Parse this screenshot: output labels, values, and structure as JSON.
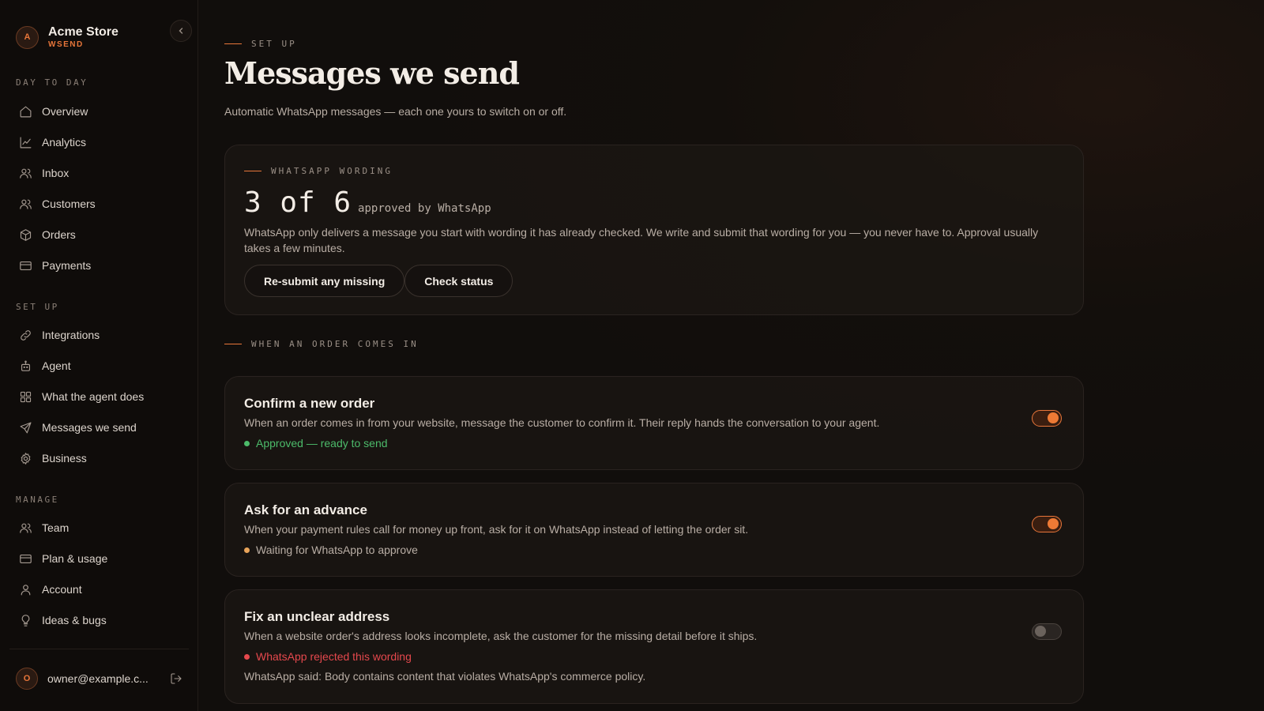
{
  "brand": {
    "initial": "A",
    "name": "Acme Store",
    "product": "WSEND"
  },
  "nav": {
    "sections": [
      {
        "label": "DAY TO DAY",
        "items": [
          {
            "label": "Overview",
            "icon": "home-icon"
          },
          {
            "label": "Analytics",
            "icon": "chart-icon"
          },
          {
            "label": "Inbox",
            "icon": "users-icon"
          },
          {
            "label": "Customers",
            "icon": "users-icon"
          },
          {
            "label": "Orders",
            "icon": "box-icon"
          },
          {
            "label": "Payments",
            "icon": "card-icon"
          }
        ]
      },
      {
        "label": "SET UP",
        "items": [
          {
            "label": "Integrations",
            "icon": "link-icon"
          },
          {
            "label": "Agent",
            "icon": "bot-icon"
          },
          {
            "label": "What the agent does",
            "icon": "grid-icon"
          },
          {
            "label": "Messages we send",
            "icon": "send-icon"
          },
          {
            "label": "Business",
            "icon": "gear-icon"
          }
        ]
      },
      {
        "label": "MANAGE",
        "items": [
          {
            "label": "Team",
            "icon": "users-icon"
          },
          {
            "label": "Plan & usage",
            "icon": "card-icon"
          },
          {
            "label": "Account",
            "icon": "user-icon"
          },
          {
            "label": "Ideas & bugs",
            "icon": "bulb-icon"
          }
        ]
      }
    ]
  },
  "user": {
    "initial": "O",
    "email": "owner@example.c..."
  },
  "page": {
    "eyebrow": "SET UP",
    "title": "Messages we send",
    "subtitle": "Automatic WhatsApp messages — each one yours to switch on or off."
  },
  "wording": {
    "eyebrow": "WHATSAPP WORDING",
    "count": "3 of 6",
    "count_suffix": "approved by WhatsApp",
    "description": "WhatsApp only delivers a message you start with wording it has already checked. We write and submit that wording for you — you never have to. Approval usually takes a few minutes.",
    "resubmit_label": "Re-submit any missing",
    "check_label": "Check status"
  },
  "order_section": {
    "eyebrow": "WHEN AN ORDER COMES IN"
  },
  "messages": [
    {
      "title": "Confirm a new order",
      "description": "When an order comes in from your website, message the customer to confirm it. Their reply hands the conversation to your agent.",
      "status": "Approved — ready to send",
      "status_color": "#4cbb6a",
      "enabled": true
    },
    {
      "title": "Ask for an advance",
      "description": "When your payment rules call for money up front, ask for it on WhatsApp instead of letting the order sit.",
      "status": "Waiting for WhatsApp to approve",
      "status_color": "#e8a45a",
      "enabled": true
    },
    {
      "title": "Fix an unclear address",
      "description": "When a website order's address looks incomplete, ask the customer for the missing detail before it ships.",
      "status": "WhatsApp rejected this wording",
      "status_color": "#e5484d",
      "extra": "WhatsApp said: Body contains content that violates WhatsApp's commerce policy.",
      "enabled": false
    }
  ],
  "colors": {
    "accent": "#e8763a",
    "approved": "#4cbb6a",
    "pending": "#e8a45a",
    "rejected": "#e5484d"
  }
}
